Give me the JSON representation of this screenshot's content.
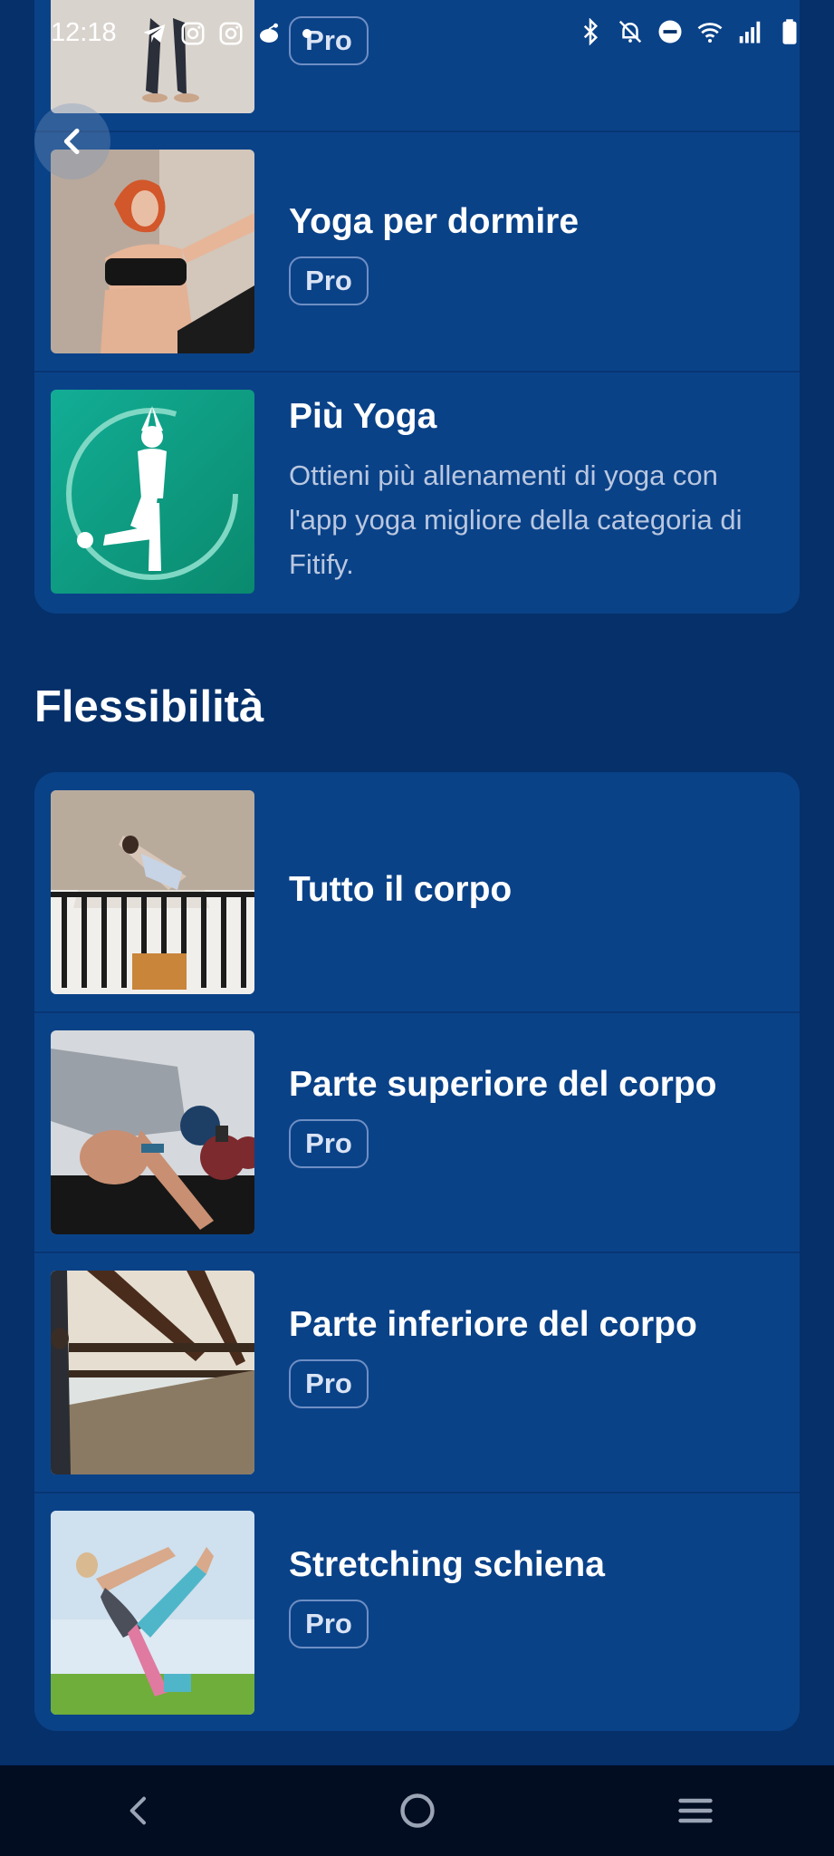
{
  "status_bar": {
    "time": "12:18",
    "left_icons": [
      "telegram-icon",
      "instagram-icon",
      "instagram-icon",
      "reddit-icon",
      "dot-icon"
    ],
    "right_icons": [
      "bluetooth-icon",
      "mute-icon",
      "do-not-disturb-icon",
      "wifi-icon",
      "signal-icon",
      "battery-icon"
    ]
  },
  "badge_label": "Pro",
  "yoga_section": {
    "items": [
      {
        "title": "",
        "pro": "Pro"
      },
      {
        "title": "Yoga per dormire",
        "pro": "Pro"
      },
      {
        "title": "Più Yoga",
        "description": "Ottieni più allenamenti di yoga con l'app yoga migliore della categoria di Fitify."
      }
    ]
  },
  "flex_section": {
    "title": "Flessibilità",
    "items": [
      {
        "title": "Tutto il corpo"
      },
      {
        "title": "Parte superiore del corpo",
        "pro": "Pro"
      },
      {
        "title": "Parte inferiore del corpo",
        "pro": "Pro"
      },
      {
        "title": "Stretching schiena",
        "pro": "Pro"
      }
    ]
  },
  "colors": {
    "background": "#05306a",
    "card": "#0a4288",
    "badge_border": "#6f8fc4",
    "nav_bar": "#020d22",
    "yoga_app_icon": "#0f9e84"
  }
}
